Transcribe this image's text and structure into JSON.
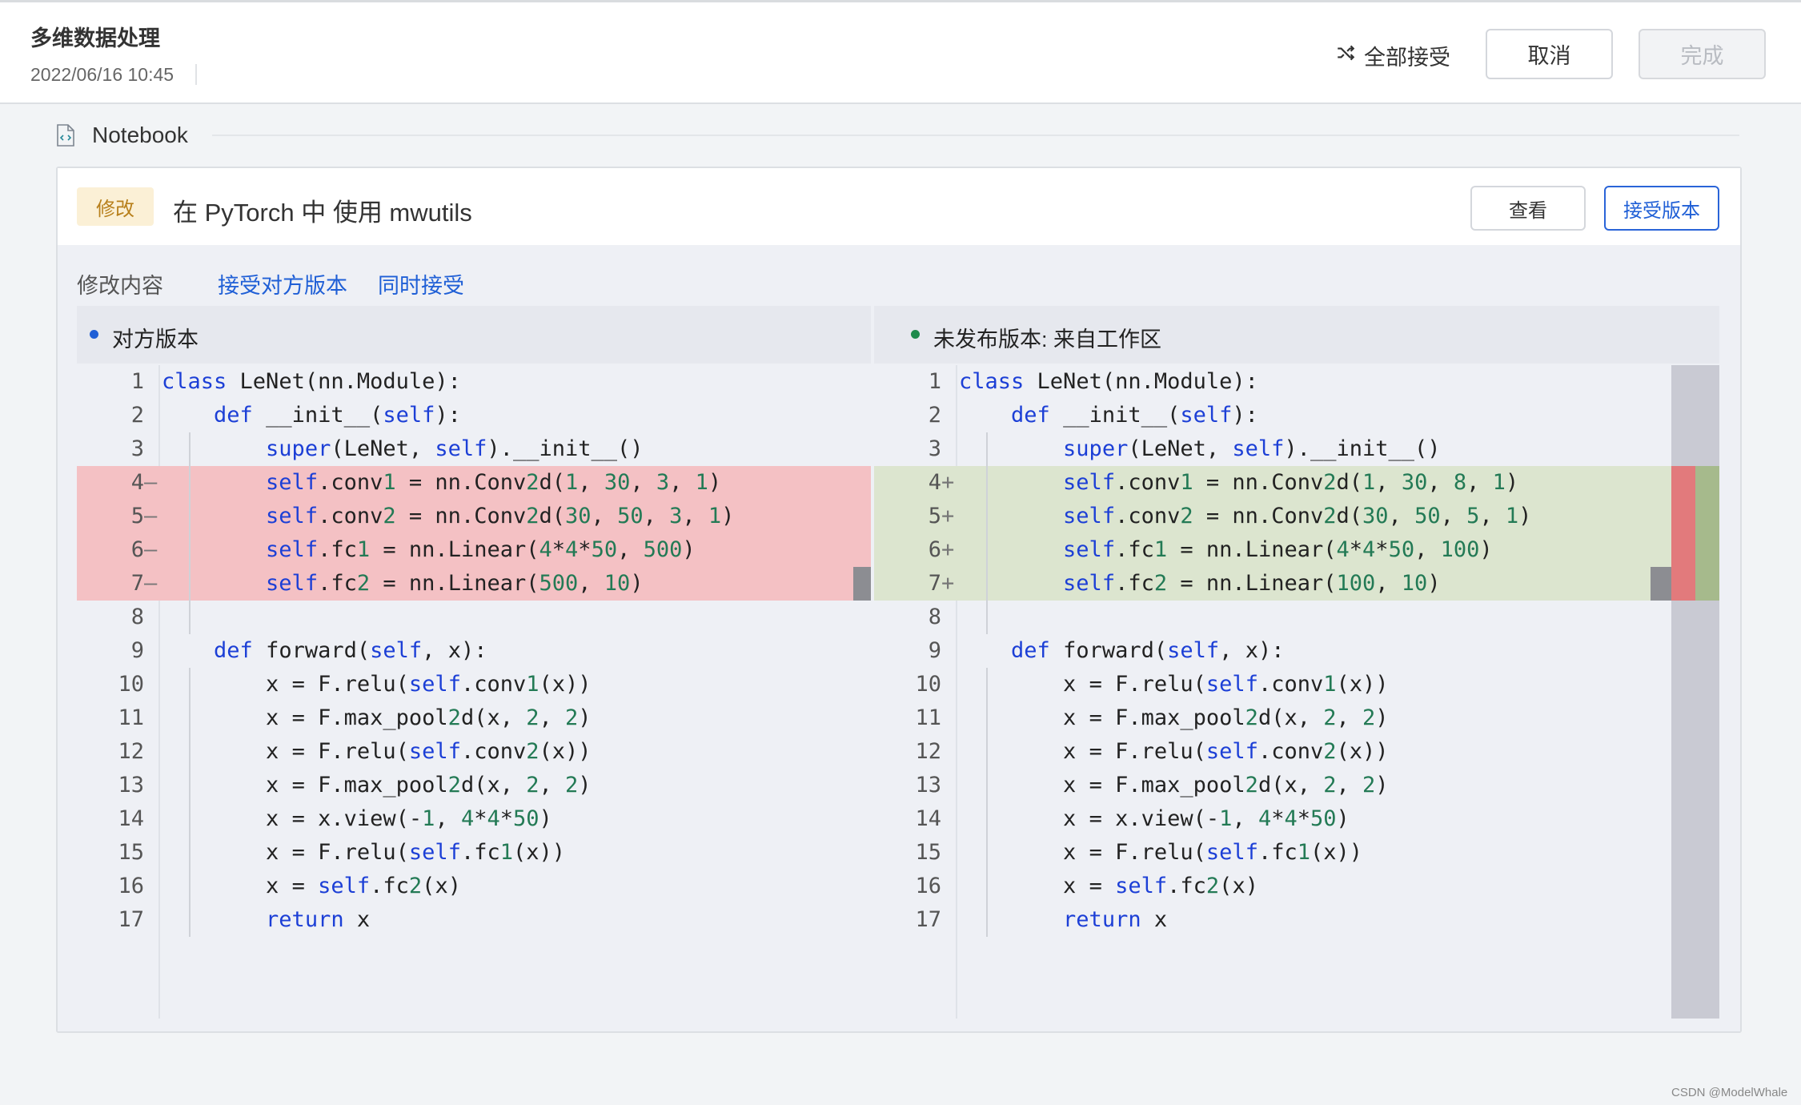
{
  "header": {
    "title": "多维数据处理",
    "date": "2022/06/16 10:45",
    "accept_all": "全部接受",
    "cancel": "取消",
    "done": "完成"
  },
  "notebook": {
    "label": "Notebook"
  },
  "card": {
    "badge": "修改",
    "title": "在 PyTorch 中 使用 mwutils",
    "view_button": "查看",
    "accept_button": "接受版本",
    "tabs": [
      "修改内容",
      "接受对方版本",
      "同时接受"
    ]
  },
  "left_pane": {
    "title": "对方版本",
    "dot_color": "#1f5fd6",
    "lines": [
      {
        "n": "1",
        "m": "",
        "t": "class LeNet(nn.Module):",
        "s": ""
      },
      {
        "n": "2",
        "m": "",
        "t": "    def __init__(self):",
        "s": ""
      },
      {
        "n": "3",
        "m": "",
        "t": "        super(LeNet, self).__init__()",
        "s": ""
      },
      {
        "n": "4",
        "m": "—",
        "t": "        self.conv1 = nn.Conv2d(1, 30, 3, 1)",
        "s": "del"
      },
      {
        "n": "5",
        "m": "—",
        "t": "        self.conv2 = nn.Conv2d(30, 50, 3, 1)",
        "s": "del"
      },
      {
        "n": "6",
        "m": "—",
        "t": "        self.fc1 = nn.Linear(4*4*50, 500)",
        "s": "del"
      },
      {
        "n": "7",
        "m": "—",
        "t": "        self.fc2 = nn.Linear(500, 10)",
        "s": "del"
      },
      {
        "n": "8",
        "m": "",
        "t": "",
        "s": ""
      },
      {
        "n": "9",
        "m": "",
        "t": "    def forward(self, x):",
        "s": ""
      },
      {
        "n": "10",
        "m": "",
        "t": "        x = F.relu(self.conv1(x))",
        "s": ""
      },
      {
        "n": "11",
        "m": "",
        "t": "        x = F.max_pool2d(x, 2, 2)",
        "s": ""
      },
      {
        "n": "12",
        "m": "",
        "t": "        x = F.relu(self.conv2(x))",
        "s": ""
      },
      {
        "n": "13",
        "m": "",
        "t": "        x = F.max_pool2d(x, 2, 2)",
        "s": ""
      },
      {
        "n": "14",
        "m": "",
        "t": "        x = x.view(-1, 4*4*50)",
        "s": ""
      },
      {
        "n": "15",
        "m": "",
        "t": "        x = F.relu(self.fc1(x))",
        "s": ""
      },
      {
        "n": "16",
        "m": "",
        "t": "        x = self.fc2(x)",
        "s": ""
      },
      {
        "n": "17",
        "m": "",
        "t": "        return x",
        "s": ""
      }
    ]
  },
  "right_pane": {
    "title": "未发布版本: 来自工作区",
    "dot_color": "#1e8a4c",
    "lines": [
      {
        "n": "1",
        "m": "",
        "t": "class LeNet(nn.Module):",
        "s": ""
      },
      {
        "n": "2",
        "m": "",
        "t": "    def __init__(self):",
        "s": ""
      },
      {
        "n": "3",
        "m": "",
        "t": "        super(LeNet, self).__init__()",
        "s": ""
      },
      {
        "n": "4",
        "m": "+",
        "t": "        self.conv1 = nn.Conv2d(1, 30, 8, 1)",
        "s": "add"
      },
      {
        "n": "5",
        "m": "+",
        "t": "        self.conv2 = nn.Conv2d(30, 50, 5, 1)",
        "s": "add"
      },
      {
        "n": "6",
        "m": "+",
        "t": "        self.fc1 = nn.Linear(4*4*50, 100)",
        "s": "add"
      },
      {
        "n": "7",
        "m": "+",
        "t": "        self.fc2 = nn.Linear(100, 10)",
        "s": "add"
      },
      {
        "n": "8",
        "m": "",
        "t": "",
        "s": ""
      },
      {
        "n": "9",
        "m": "",
        "t": "    def forward(self, x):",
        "s": ""
      },
      {
        "n": "10",
        "m": "",
        "t": "        x = F.relu(self.conv1(x))",
        "s": ""
      },
      {
        "n": "11",
        "m": "",
        "t": "        x = F.max_pool2d(x, 2, 2)",
        "s": ""
      },
      {
        "n": "12",
        "m": "",
        "t": "        x = F.relu(self.conv2(x))",
        "s": ""
      },
      {
        "n": "13",
        "m": "",
        "t": "        x = F.max_pool2d(x, 2, 2)",
        "s": ""
      },
      {
        "n": "14",
        "m": "",
        "t": "        x = x.view(-1, 4*4*50)",
        "s": ""
      },
      {
        "n": "15",
        "m": "",
        "t": "        x = F.relu(self.fc1(x))",
        "s": ""
      },
      {
        "n": "16",
        "m": "",
        "t": "        x = self.fc2(x)",
        "s": ""
      },
      {
        "n": "17",
        "m": "",
        "t": "        return x",
        "s": ""
      }
    ]
  },
  "watermark": "CSDN @ModelWhale"
}
